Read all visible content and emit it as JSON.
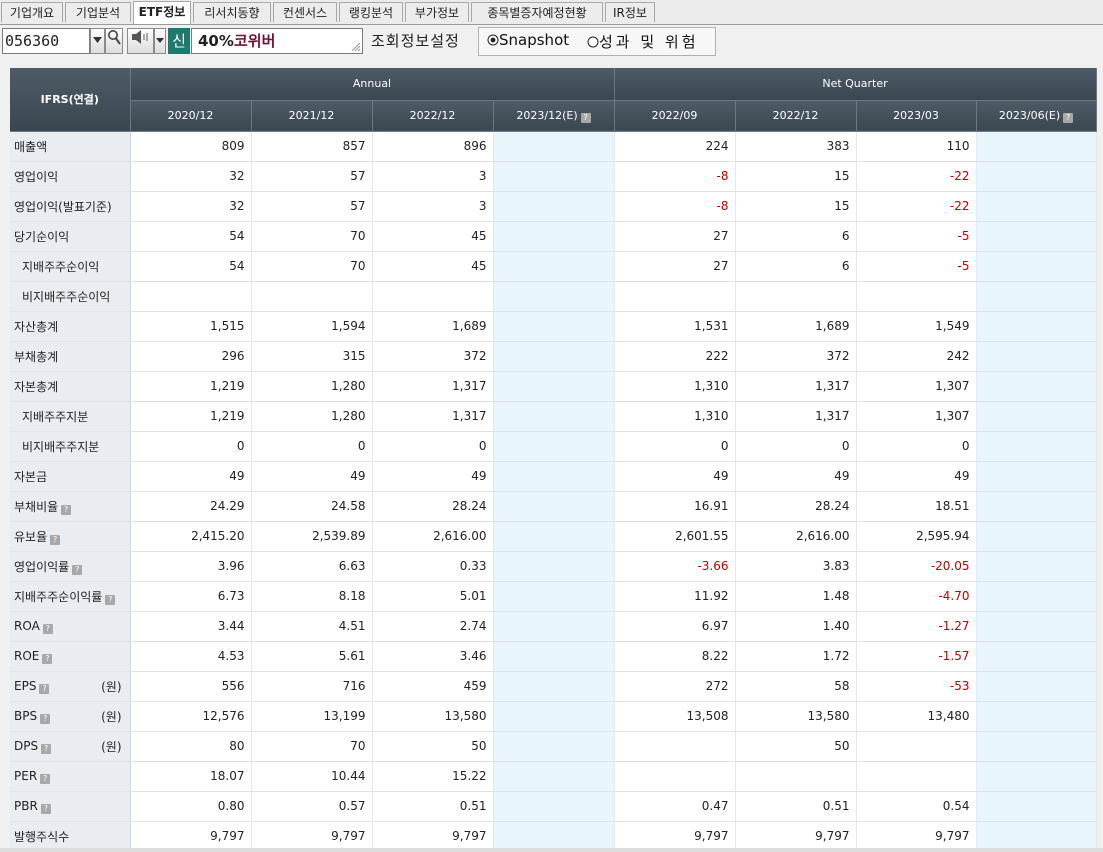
{
  "tabs": [
    {
      "label": "기업개요",
      "active": false
    },
    {
      "label": "기업분석",
      "active": false
    },
    {
      "label": "ETF정보",
      "active": true
    },
    {
      "label": "리서치동향",
      "active": false
    },
    {
      "label": "컨센서스",
      "active": false
    },
    {
      "label": "랭킹분석",
      "active": false
    },
    {
      "label": "부가정보",
      "active": false
    },
    {
      "label": "종목별증자예정현황",
      "active": false
    },
    {
      "label": "IR정보",
      "active": false
    }
  ],
  "toolbar": {
    "code": "056360",
    "dropdown_icon": "triangle-down-icon",
    "search_icon": "magnifier-icon",
    "speaker_icon": "speaker-icon",
    "badge": "신",
    "margin_pct": "40%",
    "stock_name": "코위버",
    "settings_label": "조회정보설정",
    "radio_options": [
      {
        "label": "Snapshot",
        "selected": true
      },
      {
        "label": "성과 및 위험",
        "selected": false
      }
    ]
  },
  "table": {
    "corner_label": "IFRS(연결)",
    "annual_label": "Annual",
    "quarter_label": "Net Quarter",
    "estimate_help_icon": "help-icon",
    "periods": [
      {
        "label": "2020/12",
        "estimate": false
      },
      {
        "label": "2021/12",
        "estimate": false
      },
      {
        "label": "2022/12",
        "estimate": false
      },
      {
        "label": "2023/12(E)",
        "estimate": true
      },
      {
        "label": "2022/09",
        "estimate": false
      },
      {
        "label": "2022/12",
        "estimate": false
      },
      {
        "label": "2023/03",
        "estimate": false
      },
      {
        "label": "2023/06(E)",
        "estimate": true
      }
    ],
    "rows": [
      {
        "label": "매출액",
        "sub": false,
        "help": false,
        "unit": "",
        "values": [
          "809",
          "857",
          "896",
          "",
          "224",
          "383",
          "110",
          ""
        ]
      },
      {
        "label": "영업이익",
        "sub": false,
        "help": false,
        "unit": "",
        "values": [
          "32",
          "57",
          "3",
          "",
          "-8",
          "15",
          "-22",
          ""
        ]
      },
      {
        "label": "영업이익(발표기준)",
        "sub": false,
        "help": false,
        "unit": "",
        "values": [
          "32",
          "57",
          "3",
          "",
          "-8",
          "15",
          "-22",
          ""
        ]
      },
      {
        "label": "당기순이익",
        "sub": false,
        "help": false,
        "unit": "",
        "values": [
          "54",
          "70",
          "45",
          "",
          "27",
          "6",
          "-5",
          ""
        ]
      },
      {
        "label": "지배주주순이익",
        "sub": true,
        "help": false,
        "unit": "",
        "values": [
          "54",
          "70",
          "45",
          "",
          "27",
          "6",
          "-5",
          ""
        ]
      },
      {
        "label": "비지배주주순이익",
        "sub": true,
        "help": false,
        "unit": "",
        "values": [
          "",
          "",
          "",
          "",
          "",
          "",
          "",
          ""
        ]
      },
      {
        "label": "자산총계",
        "sub": false,
        "help": false,
        "unit": "",
        "values": [
          "1,515",
          "1,594",
          "1,689",
          "",
          "1,531",
          "1,689",
          "1,549",
          ""
        ]
      },
      {
        "label": "부채총계",
        "sub": false,
        "help": false,
        "unit": "",
        "values": [
          "296",
          "315",
          "372",
          "",
          "222",
          "372",
          "242",
          ""
        ]
      },
      {
        "label": "자본총계",
        "sub": false,
        "help": false,
        "unit": "",
        "values": [
          "1,219",
          "1,280",
          "1,317",
          "",
          "1,310",
          "1,317",
          "1,307",
          ""
        ]
      },
      {
        "label": "지배주주지분",
        "sub": true,
        "help": false,
        "unit": "",
        "values": [
          "1,219",
          "1,280",
          "1,317",
          "",
          "1,310",
          "1,317",
          "1,307",
          ""
        ]
      },
      {
        "label": "비지배주주지분",
        "sub": true,
        "help": false,
        "unit": "",
        "values": [
          "0",
          "0",
          "0",
          "",
          "0",
          "0",
          "0",
          ""
        ]
      },
      {
        "label": "자본금",
        "sub": false,
        "help": false,
        "unit": "",
        "values": [
          "49",
          "49",
          "49",
          "",
          "49",
          "49",
          "49",
          ""
        ]
      },
      {
        "label": "부채비율",
        "sub": false,
        "help": true,
        "unit": "",
        "values": [
          "24.29",
          "24.58",
          "28.24",
          "",
          "16.91",
          "28.24",
          "18.51",
          ""
        ]
      },
      {
        "label": "유보율",
        "sub": false,
        "help": true,
        "unit": "",
        "values": [
          "2,415.20",
          "2,539.89",
          "2,616.00",
          "",
          "2,601.55",
          "2,616.00",
          "2,595.94",
          ""
        ]
      },
      {
        "label": "영업이익률",
        "sub": false,
        "help": true,
        "unit": "",
        "values": [
          "3.96",
          "6.63",
          "0.33",
          "",
          "-3.66",
          "3.83",
          "-20.05",
          ""
        ]
      },
      {
        "label": "지배주주순이익률",
        "sub": false,
        "help": true,
        "unit": "",
        "values": [
          "6.73",
          "8.18",
          "5.01",
          "",
          "11.92",
          "1.48",
          "-4.70",
          ""
        ]
      },
      {
        "label": "ROA",
        "sub": false,
        "help": true,
        "unit": "",
        "values": [
          "3.44",
          "4.51",
          "2.74",
          "",
          "6.97",
          "1.40",
          "-1.27",
          ""
        ]
      },
      {
        "label": "ROE",
        "sub": false,
        "help": true,
        "unit": "",
        "values": [
          "4.53",
          "5.61",
          "3.46",
          "",
          "8.22",
          "1.72",
          "-1.57",
          ""
        ]
      },
      {
        "label": "EPS",
        "sub": false,
        "help": true,
        "unit": "(원)",
        "values": [
          "556",
          "716",
          "459",
          "",
          "272",
          "58",
          "-53",
          ""
        ]
      },
      {
        "label": "BPS",
        "sub": false,
        "help": true,
        "unit": "(원)",
        "values": [
          "12,576",
          "13,199",
          "13,580",
          "",
          "13,508",
          "13,580",
          "13,480",
          ""
        ]
      },
      {
        "label": "DPS",
        "sub": false,
        "help": true,
        "unit": "(원)",
        "values": [
          "80",
          "70",
          "50",
          "",
          "",
          "50",
          "",
          ""
        ]
      },
      {
        "label": "PER",
        "sub": false,
        "help": true,
        "unit": "",
        "values": [
          "18.07",
          "10.44",
          "15.22",
          "",
          "",
          "",
          "",
          ""
        ]
      },
      {
        "label": "PBR",
        "sub": false,
        "help": true,
        "unit": "",
        "values": [
          "0.80",
          "0.57",
          "0.51",
          "",
          "0.47",
          "0.51",
          "0.54",
          ""
        ]
      },
      {
        "label": "발행주식수",
        "sub": false,
        "help": false,
        "unit": "",
        "values": [
          "9,797",
          "9,797",
          "9,797",
          "",
          "9,797",
          "9,797",
          "9,797",
          ""
        ]
      }
    ]
  },
  "colors": {
    "header_bg": "#3f4c57",
    "rowhead_bg": "#e9edf2",
    "estimate_bg": "#e8f6fb",
    "negative": "#c00000",
    "badge_bg": "#1f7a6e",
    "stock_name": "#7a0f33"
  }
}
